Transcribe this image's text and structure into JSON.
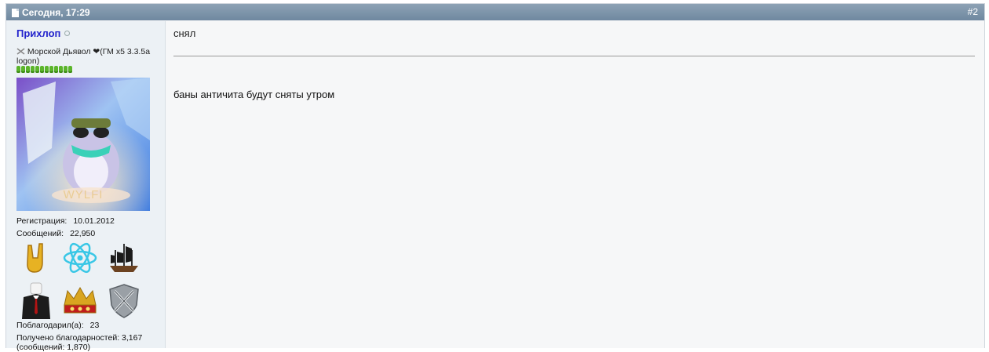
{
  "post": {
    "date": "Сегодня, 17:29",
    "number": "#2"
  },
  "user": {
    "name": "Прихлоп",
    "title": "Морской Дьявол ❤(ГМ x5 3.3.5a logon)",
    "reputation_pips": 12,
    "avatar_caption": "WYLFI",
    "registration_label": "Регистрация:",
    "registration_value": "10.01.2012",
    "messages_label": "Сообщений:",
    "messages_value": "22,950",
    "thanked_label": "Поблагодарил(а):",
    "thanked_value": "23",
    "received_label": "Получено благодарностей:",
    "received_value": "3,167",
    "received_messages": "(сообщений: 1,870)"
  },
  "awards": [
    "horns-hand-icon",
    "atom-icon",
    "pirate-ship-icon",
    "suit-man-icon",
    "crown-icon",
    "crossed-swords-shield-icon"
  ],
  "message": {
    "title": "снял",
    "body": "баны античита будут сняты утром"
  },
  "colors": {
    "header": "#7891a8",
    "username": "#2222cc",
    "reputation": "#5bb52a"
  }
}
